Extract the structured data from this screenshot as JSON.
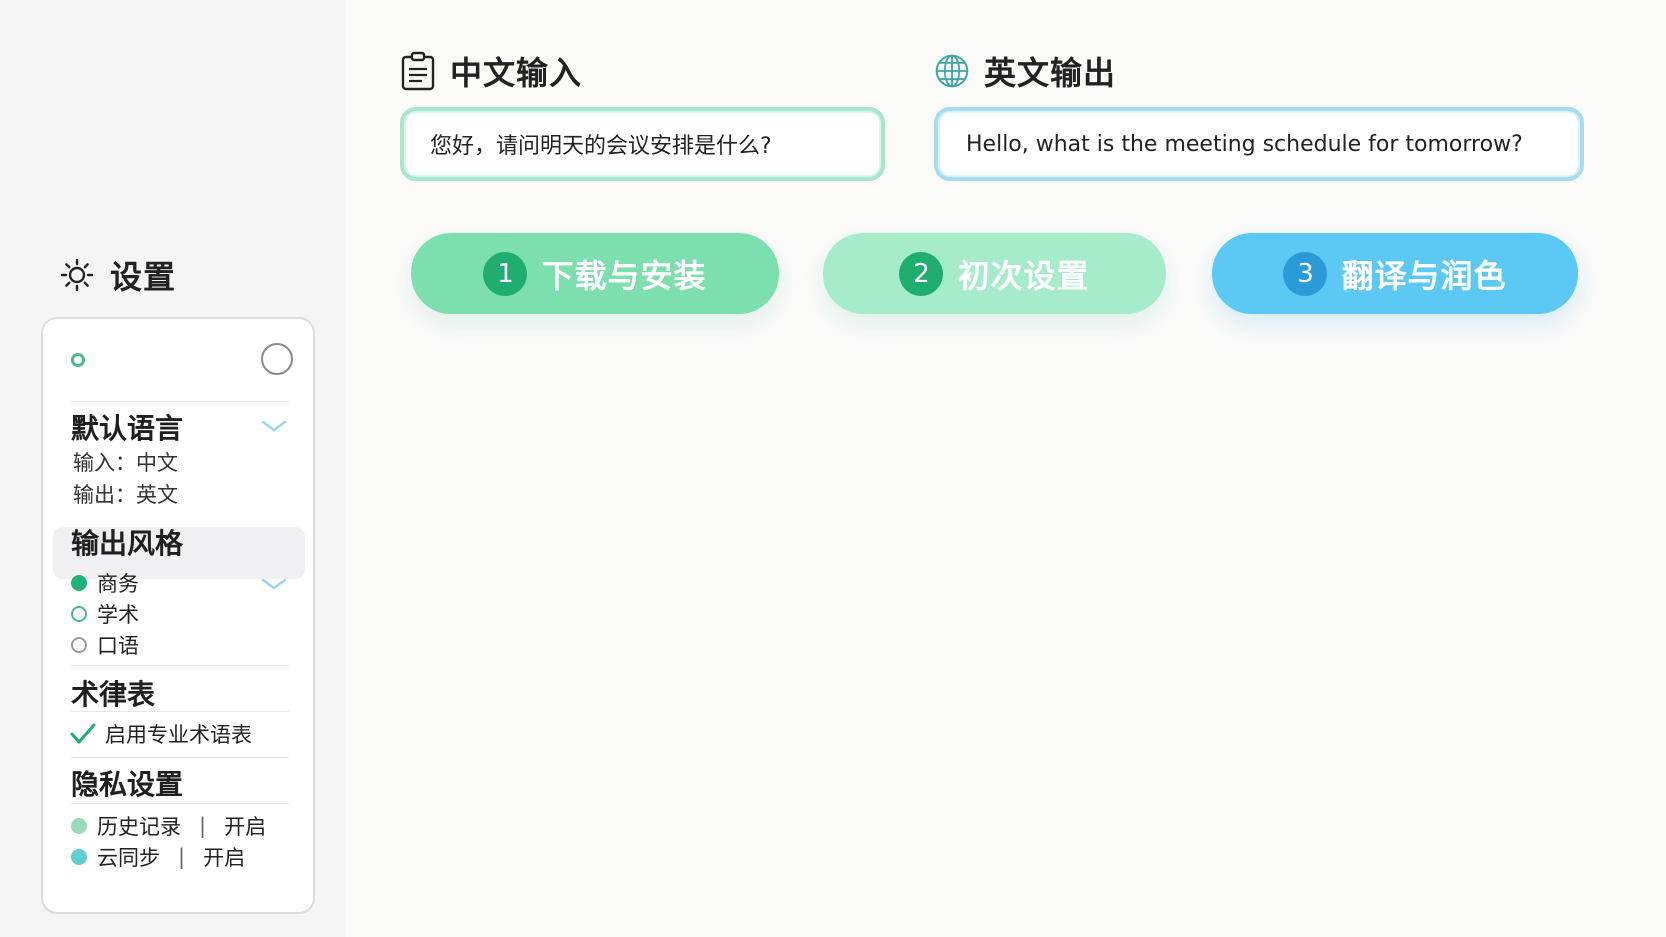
{
  "settings": {
    "title": "设置",
    "default_language": {
      "title": "默认语言",
      "input": "输入：中文",
      "output": "输出：英文"
    },
    "output_style": {
      "title": "输出风格",
      "options": [
        {
          "label": "商务",
          "state": "selected"
        },
        {
          "label": "学术",
          "state": "unselected"
        },
        {
          "label": "口语",
          "state": "unselected"
        }
      ]
    },
    "glossary": {
      "title": "术律表",
      "option": "启用专业术语表"
    },
    "privacy": {
      "title": "隐私设置",
      "items": [
        {
          "label": "历史记录",
          "value": "开启",
          "color": "#9bd9bd"
        },
        {
          "label": "云同步",
          "value": "开启",
          "color": "#5fcfd3"
        }
      ]
    }
  },
  "input_panel": {
    "title": "中文输入",
    "text": "您好，请问明天的会议安排是什么?"
  },
  "output_panel": {
    "title": "英文输出",
    "text": "Hello, what is the meeting schedule for tomorrow?"
  },
  "steps": [
    {
      "number": "1",
      "label": "下载与安装"
    },
    {
      "number": "2",
      "label": "初次设置"
    },
    {
      "number": "3",
      "label": "翻译与润色"
    }
  ],
  "colors": {
    "accent_green": "#1fae6f",
    "accent_blue": "#5cc8f4"
  }
}
